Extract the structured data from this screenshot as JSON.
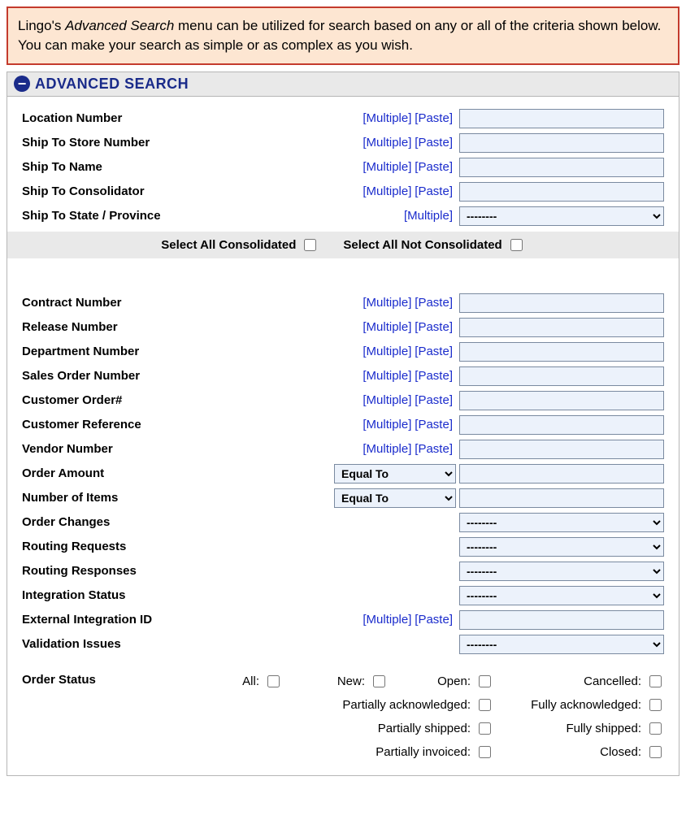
{
  "info": {
    "prefix": "Lingo's ",
    "emph": "Advanced Search",
    "rest": " menu can be utilized for search based on any or all of the criteria shown below. You can make your search as simple or as complex as you wish."
  },
  "panel": {
    "title": "ADVANCED SEARCH"
  },
  "links": {
    "multiple": "[Multiple]",
    "paste": "[Paste]"
  },
  "fields": {
    "location_number": "Location Number",
    "ship_to_store": "Ship To Store Number",
    "ship_to_name": "Ship To Name",
    "ship_to_consolidator": "Ship To Consolidator",
    "ship_to_state": "Ship To State / Province",
    "contract_number": "Contract Number",
    "release_number": "Release Number",
    "department_number": "Department Number",
    "sales_order_number": "Sales Order Number",
    "customer_order": "Customer Order#",
    "customer_reference": "Customer Reference",
    "vendor_number": "Vendor Number",
    "order_amount": "Order Amount",
    "number_of_items": "Number of Items",
    "order_changes": "Order Changes",
    "routing_requests": "Routing Requests",
    "routing_responses": "Routing Responses",
    "integration_status": "Integration Status",
    "external_integration_id": "External Integration ID",
    "validation_issues": "Validation Issues",
    "order_status": "Order Status"
  },
  "consolidated": {
    "select_all": "Select All Consolidated",
    "select_none": "Select All Not Consolidated"
  },
  "dropdowns": {
    "dashes": "--------",
    "equal_to": "Equal To"
  },
  "status": {
    "all": "All:",
    "new": "New:",
    "open": "Open:",
    "cancelled": "Cancelled:",
    "partially_ack": "Partially acknowledged:",
    "fully_ack": "Fully acknowledged:",
    "partially_shipped": "Partially shipped:",
    "fully_shipped": "Fully shipped:",
    "partially_invoiced": "Partially invoiced:",
    "closed": "Closed:"
  }
}
